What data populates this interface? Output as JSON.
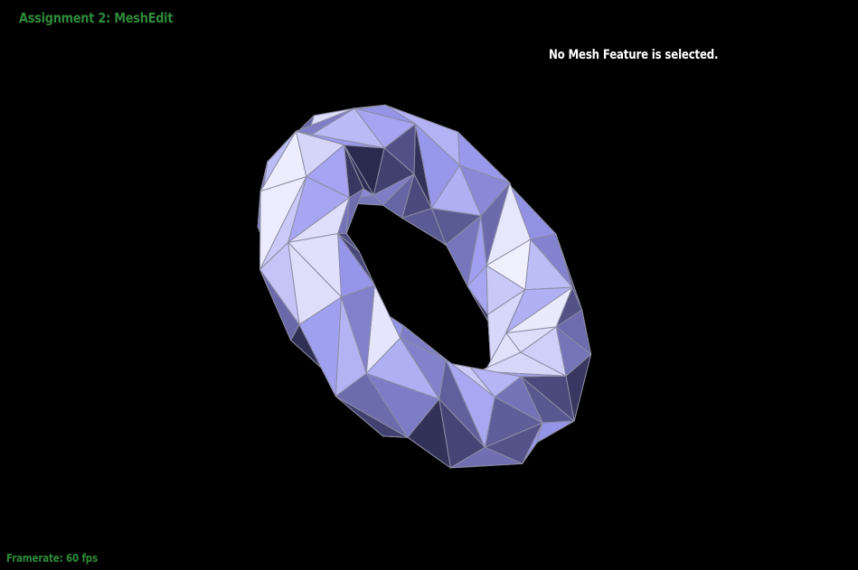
{
  "app": {
    "title": "Assignment 2: MeshEdit",
    "selection_status": "No Mesh Feature is selected.",
    "framerate_text": "Framerate: 60 fps"
  },
  "colors": {
    "background": "#000000",
    "title": "#2f8a3a",
    "status_text": "#ffffff",
    "framerate": "#2f8a3a",
    "mesh_edge": "#8c8ca4",
    "mesh_light": "#f4f4ff",
    "mesh_mid": "#9a9af0",
    "mesh_dark": "#2a2a4e"
  },
  "viewport": {
    "object": "torus mesh",
    "render_mode": "flat-shaded triangles with wireframe edges"
  }
}
